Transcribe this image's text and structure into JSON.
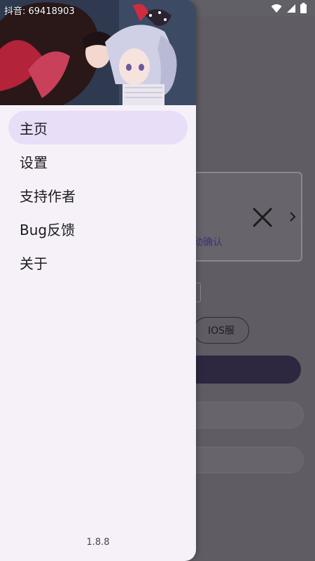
{
  "statusbar": {
    "icons": [
      "wifi-icon",
      "signal-icon",
      "battery-icon"
    ]
  },
  "drawer": {
    "header_overlay_text": "抖音: 69418903",
    "menu": [
      {
        "label": "主页",
        "active": true
      },
      {
        "label": "设置",
        "active": false
      },
      {
        "label": "支持作者",
        "active": false
      },
      {
        "label": "Bug反馈",
        "active": false
      },
      {
        "label": "关于",
        "active": false
      }
    ],
    "version": "1.8.8"
  },
  "background": {
    "card_text": "动确认",
    "chip_label": "IOS服"
  },
  "colors": {
    "drawer_bg": "#f6f1f8",
    "active_item_bg": "#e8def8",
    "scrim": "#5f5c63",
    "primary_button": "#2e2740"
  }
}
